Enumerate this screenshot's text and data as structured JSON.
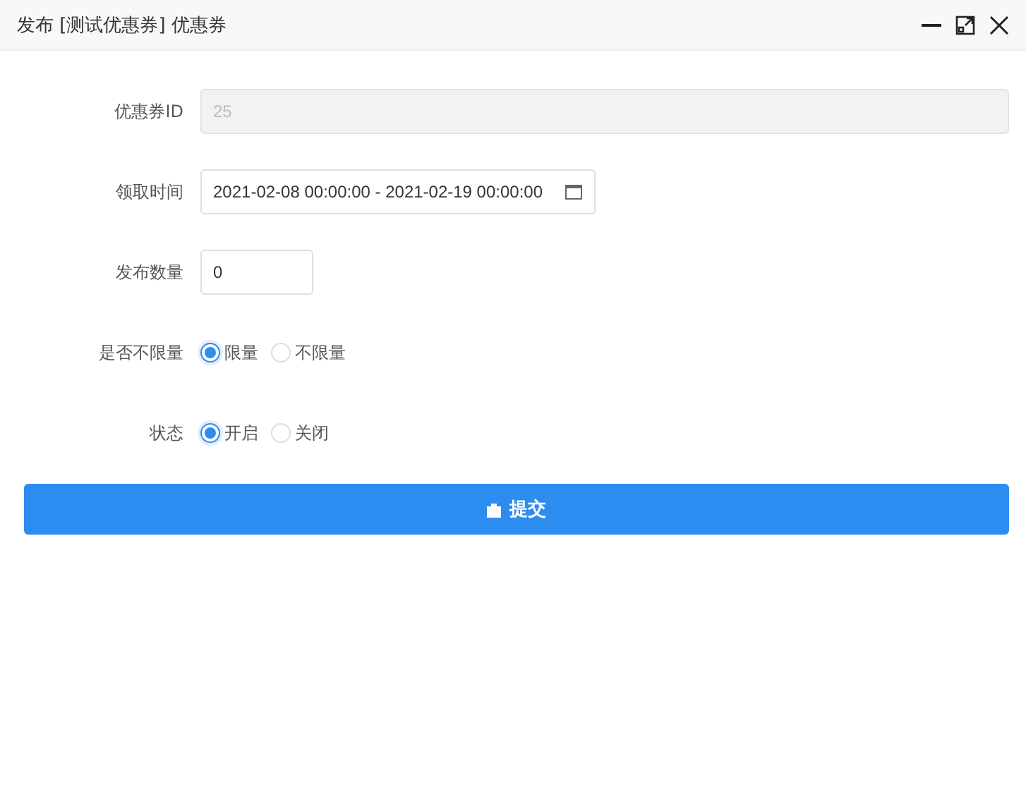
{
  "window": {
    "title": "发布 [测试优惠券] 优惠券"
  },
  "fields": [
    {
      "kind": "input",
      "label": "优惠券ID",
      "value": "25",
      "disabled": true
    },
    {
      "kind": "date",
      "label": "领取时间",
      "value": "2021-02-08 00:00:00 - 2021-02-19 00:00:00"
    },
    {
      "kind": "number",
      "label": "发布数量",
      "value": "0",
      "disabled": false
    },
    {
      "kind": "radio",
      "label": "是否不限量",
      "options": [
        {
          "label": "限量",
          "selected": true
        },
        {
          "label": "不限量",
          "selected": false
        }
      ]
    },
    {
      "kind": "radio",
      "label": "状态",
      "options": [
        {
          "label": "开启",
          "selected": true
        },
        {
          "label": "关闭",
          "selected": false
        }
      ]
    }
  ],
  "submit": {
    "label": "提交"
  }
}
